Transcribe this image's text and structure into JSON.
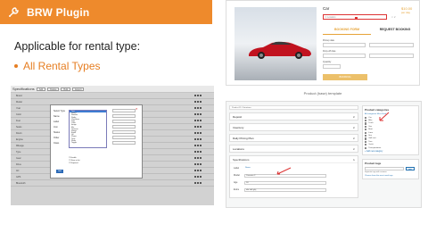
{
  "banner": {
    "title": "BRW Plugin",
    "color": "#ee8a2c",
    "logo_icon": "wrench-icon"
  },
  "heading": "Applicable for rental type:",
  "rental_type": "All Rental Types",
  "left_screenshot": {
    "title": "Specifications",
    "toolbar_buttons": [
      "Add",
      "Delete",
      "Bulk",
      "Export"
    ],
    "rows": [
      "Brand",
      "Model",
      "Year",
      "Color",
      "Fuel",
      "Seats",
      "Doors",
      "Engine",
      "Mileage",
      "Type",
      "Gear",
      "Drive",
      "AC",
      "GPS",
      "Bluetooth"
    ],
    "modal": {
      "fields": [
        "Select Type",
        "Name",
        "Label",
        "Icon",
        "Status",
        "Order",
        "Class"
      ],
      "list_options": [
        "Text",
        "Select",
        "Number",
        "Radio",
        "Checkbox",
        "Date",
        "Color",
        "Image",
        "File",
        "Textarea",
        "Range",
        "Email",
        "Url",
        "Phone",
        "Time",
        "Slider",
        "Toggle"
      ],
      "selected_index": 0,
      "checkboxes": [
        "Enable",
        "Show in list",
        "Required"
      ],
      "add_button": "Add",
      "close_icon": "close-icon"
    }
  },
  "product_screenshot": {
    "car_title": "Car",
    "price": "$10.00",
    "price_sub": "per day",
    "qty_box_text": "1 Location",
    "tabs": [
      "BOOKING FORM",
      "REQUEST BOOKING"
    ],
    "pickup_label": "Pickup date",
    "dropoff_label": "Drop-off date",
    "quantity_label": "Quantity",
    "book_button": "BOOKING",
    "accent": "#e6a337"
  },
  "caption": "Product (base) template",
  "admin_screenshot": {
    "topbar": "Product ID / Variations",
    "sections": [
      "Deposit",
      "Inventory",
      "Daily Pricing Plan",
      "Locations"
    ],
    "spec_title": "Specifications",
    "spec_rows": [
      {
        "label": "Label",
        "value": "Name"
      },
      {
        "label": "Model",
        "value": "Carrento 2"
      },
      {
        "label": "Age",
        "value": "18"
      },
      {
        "label": "Extra",
        "value": "abc  def  ghij"
      }
    ],
    "categories_title": "Product categories",
    "categories_tabs": "All categories   Most Used",
    "categories": [
      {
        "label": "Car",
        "checked": true
      },
      {
        "label": "Bike",
        "checked": false
      },
      {
        "label": "Truck",
        "checked": false
      },
      {
        "label": "Van",
        "checked": false
      },
      {
        "label": "Boat",
        "checked": false
      },
      {
        "label": "Limo",
        "checked": false
      },
      {
        "label": "Suv",
        "checked": false
      },
      {
        "label": "Golf cart",
        "checked": false
      },
      {
        "label": "Tour",
        "checked": false
      },
      {
        "label": "Yacht",
        "checked": false
      },
      {
        "label": "Transportation",
        "checked": false
      }
    ],
    "add_category": "+ Add new category",
    "tags_title": "Product tags",
    "tags_add_button": "Add",
    "tags_note": "Separate tags with commas",
    "tags_choose": "Choose from the most used tags"
  }
}
